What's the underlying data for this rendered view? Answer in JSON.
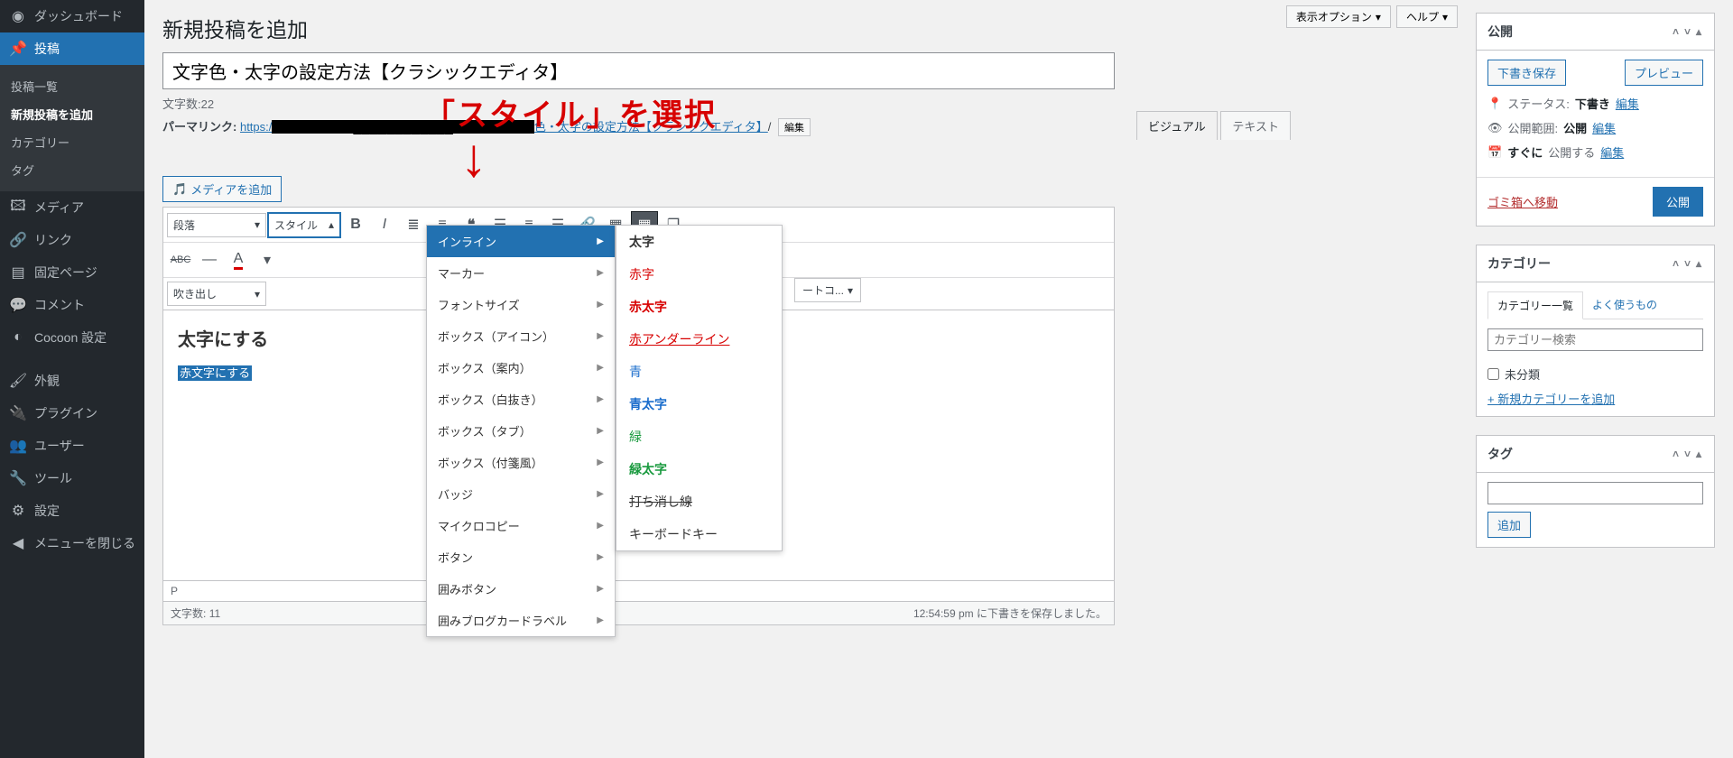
{
  "sidebar": {
    "dashboard": "ダッシュボード",
    "posts": "投稿",
    "posts_sub": [
      "投稿一覧",
      "新規投稿を追加",
      "カテゴリー",
      "タグ"
    ],
    "media": "メディア",
    "links": "リンク",
    "pages": "固定ページ",
    "comments": "コメント",
    "cocoon": "Cocoon 設定",
    "appearance": "外観",
    "plugins": "プラグイン",
    "users": "ユーザー",
    "tools": "ツール",
    "settings": "設定",
    "collapse": "メニューを閉じる"
  },
  "top": {
    "screen_options": "表示オプション",
    "help": "ヘルプ"
  },
  "page": {
    "heading": "新規投稿を追加",
    "title_value": "文字色・太字の設定方法【クラシックエディタ】",
    "wordcount_label": "文字数:",
    "wordcount": "22",
    "permalink_label": "パーマリンク:",
    "permalink_prefix": "https:/",
    "permalink_mid": "色・太字の設定方法【クラシックエディタ】",
    "permalink_suffix": "/",
    "edit": "編集",
    "annotation": "「スタイル」を選択",
    "add_media": "メディアを追加",
    "tab_visual": "ビジュアル",
    "tab_text": "テキスト"
  },
  "toolbar": {
    "paragraph": "段落",
    "style": "スタイル",
    "balloon": "吹き出し",
    "shortcode": "ートコ...",
    "font_letter": "A"
  },
  "style_menu": [
    "インライン",
    "マーカー",
    "フォントサイズ",
    "ボックス（アイコン）",
    "ボックス（案内）",
    "ボックス（白抜き）",
    "ボックス（タブ）",
    "ボックス（付箋風）",
    "バッジ",
    "マイクロコピー",
    "ボタン",
    "囲みボタン",
    "囲みブログカードラベル"
  ],
  "inline_menu": [
    {
      "label": "太字",
      "cls": "bold"
    },
    {
      "label": "赤字",
      "cls": "red"
    },
    {
      "label": "赤太字",
      "cls": "redbold"
    },
    {
      "label": "赤アンダーライン",
      "cls": "redunder"
    },
    {
      "label": "青",
      "cls": "blue"
    },
    {
      "label": "青太字",
      "cls": "bluebold"
    },
    {
      "label": "緑",
      "cls": "green"
    },
    {
      "label": "緑太字",
      "cls": "greenbold"
    },
    {
      "label": "打ち消し線",
      "cls": "strike"
    },
    {
      "label": "キーボードキー",
      "cls": ""
    }
  ],
  "content": {
    "h2": "太字にする",
    "selected": "赤文字にする"
  },
  "status": {
    "path": "P",
    "wordcount_label": "文字数:",
    "wordcount": "11",
    "saved": "12:54:59 pm に下書きを保存しました。"
  },
  "publish": {
    "title": "公開",
    "save_draft": "下書き保存",
    "preview": "プレビュー",
    "status_label": "ステータス:",
    "status_val": "下書き",
    "edit": "編集",
    "visibility_label": "公開範囲:",
    "visibility_val": "公開",
    "immediately": "すぐに",
    "publish_text": "公開する",
    "trash": "ゴミ箱へ移動",
    "publish_btn": "公開"
  },
  "category": {
    "title": "カテゴリー",
    "tab_all": "カテゴリー一覧",
    "tab_freq": "よく使うもの",
    "search_ph": "カテゴリー検索",
    "uncategorized": "未分類",
    "add_new": "+ 新規カテゴリーを追加"
  },
  "tags": {
    "title": "タグ",
    "add": "追加"
  }
}
